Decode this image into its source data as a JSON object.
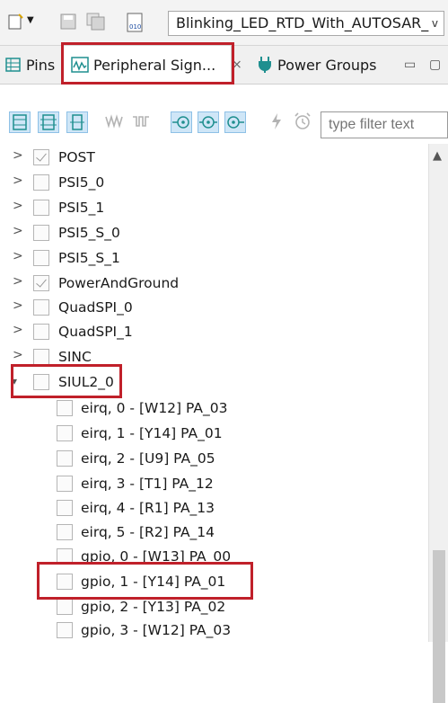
{
  "toolbar": {
    "combo_value": "Blinking_LED_RTD_With_AUTOSAR_",
    "combo_arrow": "v"
  },
  "tabs": [
    {
      "label": "Pins",
      "icon": "table-icon"
    },
    {
      "label": "Peripheral Sign...",
      "icon": "waveform-icon"
    },
    {
      "label": "Power Groups",
      "icon": "plug-icon"
    }
  ],
  "filter": {
    "placeholder": "type filter text"
  },
  "tree": {
    "items": [
      {
        "label": "POST",
        "checked": true
      },
      {
        "label": "PSI5_0",
        "checked": false
      },
      {
        "label": "PSI5_1",
        "checked": false
      },
      {
        "label": "PSI5_S_0",
        "checked": false
      },
      {
        "label": "PSI5_S_1",
        "checked": false
      },
      {
        "label": "PowerAndGround",
        "checked": true
      },
      {
        "label": "QuadSPI_0",
        "checked": false
      },
      {
        "label": "QuadSPI_1",
        "checked": false
      },
      {
        "label": "SINC",
        "checked": false
      },
      {
        "label": "SIUL2_0",
        "checked": false,
        "expanded": true
      }
    ],
    "children": [
      {
        "label": "eirq, 0 - [W12] PA_03"
      },
      {
        "label": "eirq, 1 - [Y14] PA_01"
      },
      {
        "label": "eirq, 2 - [U9] PA_05"
      },
      {
        "label": "eirq, 3 - [T1] PA_12"
      },
      {
        "label": "eirq, 4 - [R1] PA_13"
      },
      {
        "label": "eirq, 5 - [R2] PA_14"
      },
      {
        "label": "gpio, 0 - [W13] PA_00"
      },
      {
        "label": "gpio, 1 - [Y14] PA_01"
      },
      {
        "label": "gpio, 2 - [Y13] PA_02"
      },
      {
        "label": "gpio, 3 - [W12] PA_03"
      }
    ]
  },
  "colors": {
    "highlight": "#c0202a",
    "toggle_selected": "#cfe6f7",
    "teal_icon": "#1f8f8f"
  }
}
